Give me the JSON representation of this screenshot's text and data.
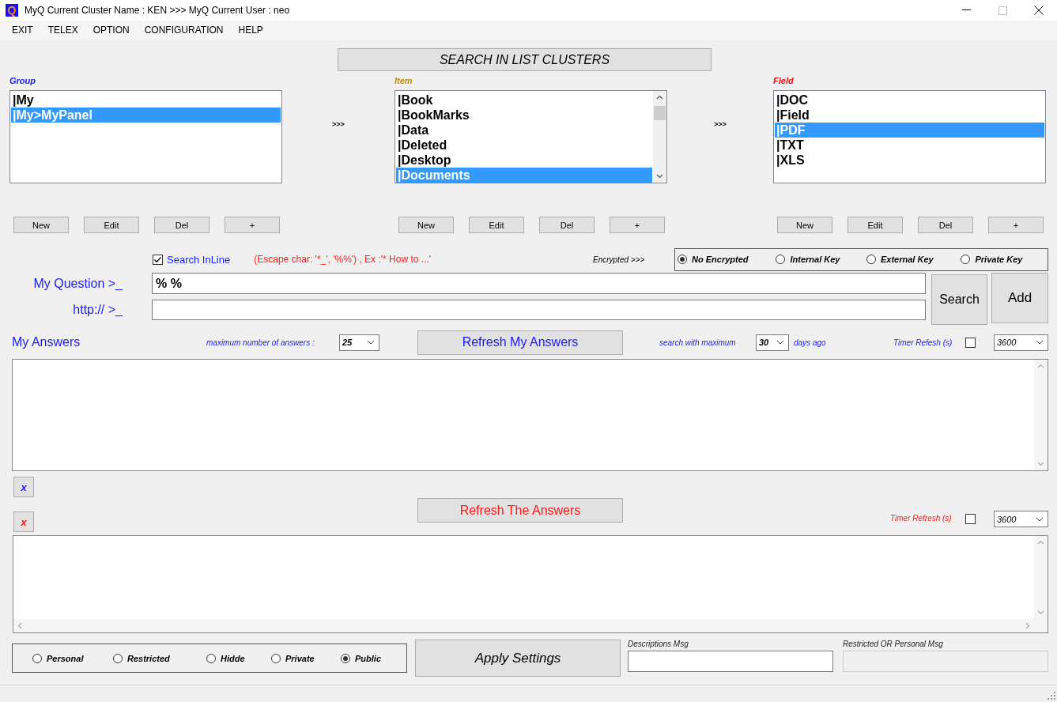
{
  "window": {
    "logo": "Q",
    "title": "MyQ Current Cluster Name : KEN >>> MyQ Current User : neo"
  },
  "menu": [
    "EXIT",
    "TELEX",
    "OPTION",
    "CONFIGURATION",
    "HELP"
  ],
  "search_header": "SEARCH IN LIST CLUSTERS",
  "lists": [
    {
      "kind": "group",
      "label": "Group",
      "scrollbar": false,
      "items": [
        {
          "text": "|My",
          "selected": false
        },
        {
          "text": "|My>MyPanel",
          "selected": true
        }
      ],
      "buttons": [
        "New",
        "Edit",
        "Del",
        "+"
      ],
      "arrow": ">>>"
    },
    {
      "kind": "item",
      "label": "Item",
      "scrollbar": true,
      "items": [
        {
          "text": "|Book",
          "selected": false
        },
        {
          "text": "|BookMarks",
          "selected": false
        },
        {
          "text": "|Data",
          "selected": false
        },
        {
          "text": "|Deleted",
          "selected": false
        },
        {
          "text": "|Desktop",
          "selected": false
        },
        {
          "text": "|Documents",
          "selected": true
        }
      ],
      "buttons": [
        "New",
        "Edit",
        "Del",
        "+"
      ],
      "arrow": ">>>"
    },
    {
      "kind": "field",
      "label": "Field",
      "scrollbar": false,
      "items": [
        {
          "text": "|DOC",
          "selected": false
        },
        {
          "text": "|Field",
          "selected": false
        },
        {
          "text": "|PDF",
          "selected": true
        },
        {
          "text": "|TXT",
          "selected": false
        },
        {
          "text": "|XLS",
          "selected": false
        }
      ],
      "buttons": [
        "New",
        "Edit",
        "Del",
        "+"
      ]
    }
  ],
  "search_inline": {
    "label": "Search InLine",
    "checked": true
  },
  "escape_hint": "(Escape char: '*_', '%%') , Ex :'* How to ...'",
  "encrypted_label": "Encrypted >>>",
  "encryption": [
    {
      "label": "No Encrypted",
      "selected": true
    },
    {
      "label": "Internal Key",
      "selected": false
    },
    {
      "label": "External Key",
      "selected": false
    },
    {
      "label": "Private Key",
      "selected": false
    }
  ],
  "question": {
    "label": "My Question >_",
    "value": "% %"
  },
  "url": {
    "label": "http:// >_"
  },
  "search_button": "Search",
  "add_button": "Add",
  "my_answers": {
    "title": "My Answers",
    "max_label": "maximum number of answers :",
    "max_value": "25",
    "refresh": "Refresh My Answers",
    "days_label": "search with maximum",
    "days_value": "30",
    "days_suffix": "days ago",
    "timer_label": "Timer Refesh (s)",
    "timer_checked": false,
    "timer_value": "3600"
  },
  "clear_buttons": [
    "x",
    "x"
  ],
  "the_answers": {
    "refresh": "Refresh The Answers",
    "timer_label": "Timer Refresh (s)",
    "timer_checked": false,
    "timer_value": "3600"
  },
  "visibility": [
    {
      "label": "Personal",
      "selected": false
    },
    {
      "label": "Restricted",
      "selected": false
    },
    {
      "label": "Hidde",
      "selected": false
    },
    {
      "label": "Private",
      "selected": false
    },
    {
      "label": "Public",
      "selected": true
    }
  ],
  "apply_button": "Apply Settings",
  "descriptions": {
    "label": "Descriptions Msg"
  },
  "restricted_msg": {
    "label": "Restricted OR Personal Msg",
    "disabled": true
  }
}
